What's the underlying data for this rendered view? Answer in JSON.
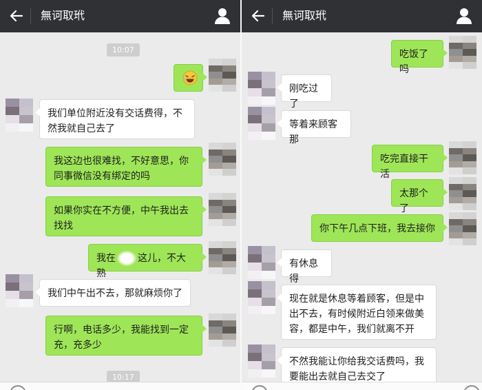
{
  "left": {
    "header": {
      "title": "無诃取玳"
    },
    "time1": "10:07",
    "time2": "10:17",
    "messages": [
      {
        "text": "我们单位附近没有交话费得，不然我就自己去了"
      },
      {
        "text": "我这边也很难找，不好意思，你同事微信没有绑定的吗"
      },
      {
        "text": "如果你实在不方便，中午我出去找找"
      },
      {
        "pre": "我在",
        "post": "这儿，不大熟"
      },
      {
        "text": "我们中午出不去，那就麻烦你了"
      },
      {
        "text": "行啊，电话多少，我能找到一定充，充多少"
      }
    ]
  },
  "right": {
    "header": {
      "title": "無诃取玳"
    },
    "messages": [
      {
        "text": "吃饭了吗"
      },
      {
        "text": "刚吃过了"
      },
      {
        "text": "等着来顾客那"
      },
      {
        "text": "吃完直接干活"
      },
      {
        "text": "太那个了"
      },
      {
        "text": "你下午几点下班，我去接你"
      },
      {
        "text": "有休息得"
      },
      {
        "text": "现在就是休息等着顾客，但是中出不去，有时候附近白领来做美容，都是中午，我们就离不开"
      },
      {
        "text": "不然我能让你给我交话费吗，我要能出去就自己去交了"
      }
    ]
  },
  "colors": {
    "topbar": "#2f3135",
    "background": "#ebebeb",
    "outgoing_bubble": "#9ee657",
    "incoming_bubble": "#ffffff"
  },
  "icons": {
    "back": "arrow-left-icon",
    "contact": "user-icon",
    "emoji": "laughing-emoji-icon"
  }
}
